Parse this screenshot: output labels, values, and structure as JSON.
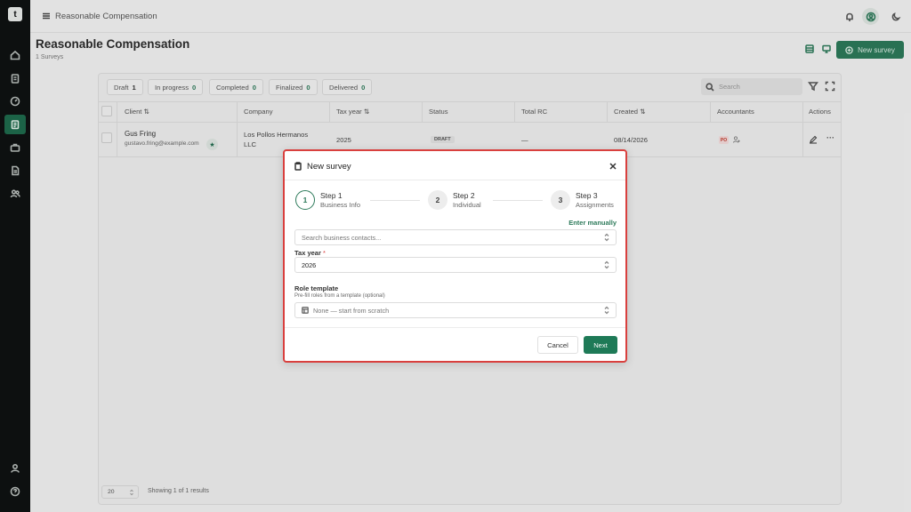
{
  "app": {
    "logo_text": "t",
    "breadcrumb": "Reasonable Compensation"
  },
  "page": {
    "title": "Reasonable Compensation",
    "subtitle": "1 Surveys",
    "new_survey_label": "New survey"
  },
  "filters": [
    {
      "label": "Draft",
      "count": "1"
    },
    {
      "label": "In progress",
      "count": "0"
    },
    {
      "label": "Completed",
      "count": "0"
    },
    {
      "label": "Finalized",
      "count": "0"
    },
    {
      "label": "Delivered",
      "count": "0"
    }
  ],
  "search": {
    "placeholder": "Search"
  },
  "table": {
    "columns": [
      "Client",
      "Company",
      "Tax year",
      "Status",
      "Total RC",
      "Created",
      "Accountants",
      "Actions"
    ],
    "sort_glyph": "⇅",
    "rows": [
      {
        "client_name": "Gus Fring",
        "client_email": "gustavo.fring@example.com",
        "company_line1": "Los Pollos Hermanos",
        "company_line2": "LLC",
        "tax_year": "2025",
        "status": "DRAFT",
        "total_rc": "—",
        "created": "08/14/2026",
        "accountant_initials": "PO",
        "actions_more": "···"
      }
    ]
  },
  "pagination": {
    "page_size": "20",
    "summary": "Showing 1 of 1 results"
  },
  "modal": {
    "title": "New survey",
    "steps": [
      {
        "number": "1",
        "title": "Step 1",
        "subtitle": "Business Info"
      },
      {
        "number": "2",
        "title": "Step 2",
        "subtitle": "Individual"
      },
      {
        "number": "3",
        "title": "Step 3",
        "subtitle": "Assignments"
      }
    ],
    "enter_manually": "Enter manually",
    "business_search_placeholder": "Search business contacts...",
    "tax_year_label": "Tax year",
    "required_marker": "*",
    "tax_year_value": "2026",
    "role_template_label": "Role template",
    "role_template_hint": "Pre-fill roles from a template (optional)",
    "role_template_value": "None — start from scratch",
    "cancel_label": "Cancel",
    "next_label": "Next"
  },
  "colors": {
    "accent": "#2d7a5a",
    "modal_border": "#d9403e",
    "sidebar": "#0f1212"
  }
}
